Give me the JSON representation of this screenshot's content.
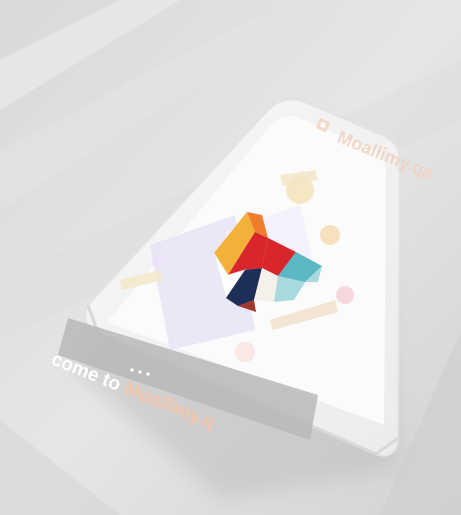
{
  "app": {
    "brand_name": "Moallimy.qa",
    "welcome_prefix": "come to ",
    "welcome_brand": "Moallimy.q"
  },
  "icons": {
    "logo": "moallimy-heart-logo-icon",
    "brand_mark": "brand-mark-icon",
    "pager": "page-indicator-dots-icon"
  },
  "colors": {
    "logo_yellow": "#f4b13a",
    "logo_orange": "#ef7d2e",
    "logo_red": "#d8262c",
    "logo_navy": "#1d2f58",
    "logo_teal": "#5bb7c4",
    "logo_light_teal": "#a7d9df",
    "brand_text": "#f0d2c2"
  }
}
